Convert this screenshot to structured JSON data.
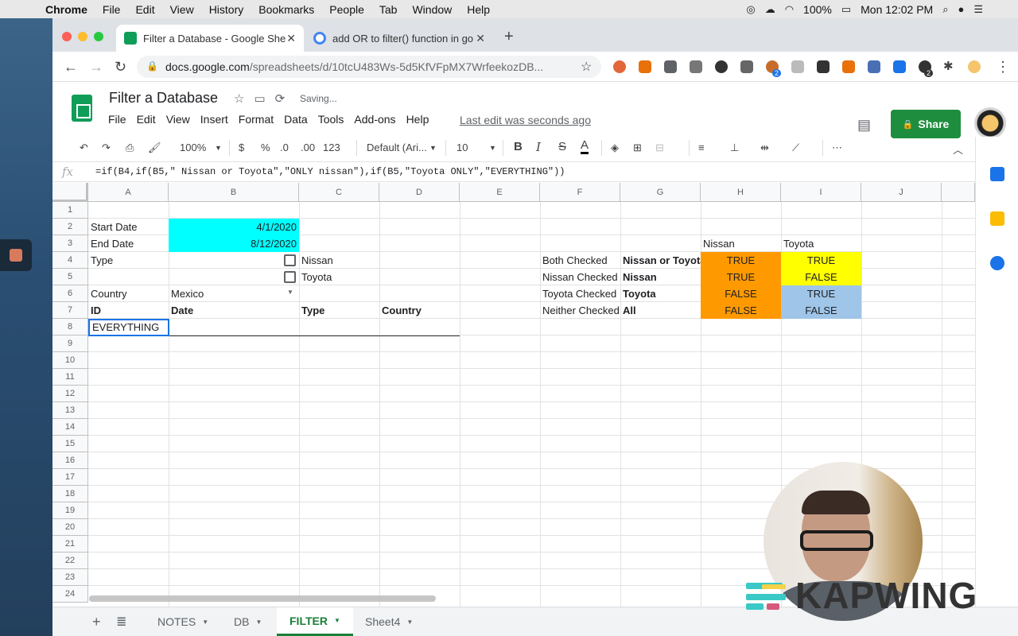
{
  "mac_menu": {
    "app": "Chrome",
    "items": [
      "File",
      "Edit",
      "View",
      "History",
      "Bookmarks",
      "People",
      "Tab",
      "Window",
      "Help"
    ],
    "battery": "100%",
    "clock": "Mon 12:02 PM"
  },
  "browser": {
    "tabs": [
      {
        "title": "Filter a Database - Google She",
        "active": true
      },
      {
        "title": "add OR to filter() function in go",
        "active": false
      }
    ],
    "url_host": "docs.google.com",
    "url_path": "/spreadsheets/d/10tcU483Ws-5d5KfVFpMX7WrfeekozDB...",
    "extension_badge_1": "2",
    "extension_badge_2": "2"
  },
  "doc": {
    "title": "Filter a Database",
    "status": "Saving...",
    "menu": [
      "File",
      "Edit",
      "View",
      "Insert",
      "Format",
      "Data",
      "Tools",
      "Add-ons",
      "Help"
    ],
    "last_edit": "Last edit was seconds ago",
    "share_label": "Share"
  },
  "format_toolbar": {
    "zoom": "100%",
    "currency": "$",
    "percent": "%",
    "dec_less": ".0",
    "dec_more": ".00",
    "more_formats": "123",
    "font": "Default (Ari...",
    "font_size": "10",
    "bold": "B",
    "italic": "I",
    "strike": "S",
    "text_color": "A",
    "more": "⋯"
  },
  "formula": {
    "fx": "fx",
    "text": "=if(B4,if(B5,\" Nissan or Toyota\",\"ONLY nissan\"),if(B5,\"Toyota ONLY\",\"EVERYTHING\"))"
  },
  "columns": [
    "A",
    "B",
    "C",
    "D",
    "E",
    "F",
    "G",
    "H",
    "I",
    "J"
  ],
  "rows": [
    "1",
    "2",
    "3",
    "4",
    "5",
    "6",
    "7",
    "8",
    "9",
    "10",
    "11",
    "12",
    "13",
    "14",
    "15",
    "16",
    "17",
    "18",
    "19",
    "20",
    "21",
    "22",
    "23",
    "24"
  ],
  "cells": {
    "a2": "Start Date",
    "b2": "4/1/2020",
    "a3": "End Date",
    "b3": "8/12/2020",
    "a4": "Type",
    "c4": "Nissan",
    "c5": "Toyota",
    "a6": "Country",
    "b6": "Mexico",
    "a7": "ID",
    "b7": "Date",
    "c7": "Type",
    "d7": "Country",
    "a8": "EVERYTHING",
    "h3": "Nissan",
    "i3": "Toyota",
    "f4": "Both Checked",
    "g4": "Nissan or Toyota",
    "h4": "TRUE",
    "i4": "TRUE",
    "f5": "Nissan Checked",
    "g5": "Nissan",
    "h5": "TRUE",
    "i5": "FALSE",
    "f6": "Toyota Checked",
    "g6": "Toyota",
    "h6": "FALSE",
    "i6": "TRUE",
    "f7": "Neither Checked",
    "g7": "All",
    "h7": "FALSE",
    "i7": "FALSE"
  },
  "sheet_tabs": [
    {
      "label": "NOTES",
      "active": false
    },
    {
      "label": "DB",
      "active": false
    },
    {
      "label": "FILTER",
      "active": true
    },
    {
      "label": "Sheet4",
      "active": false
    }
  ],
  "watermark": "KAPWING",
  "colors": {
    "cyan": "#00ffff",
    "orange": "#ff9900",
    "yellow": "#ffff00",
    "light_blue": "#9fc5e8",
    "share_green": "#1e8e3e"
  }
}
